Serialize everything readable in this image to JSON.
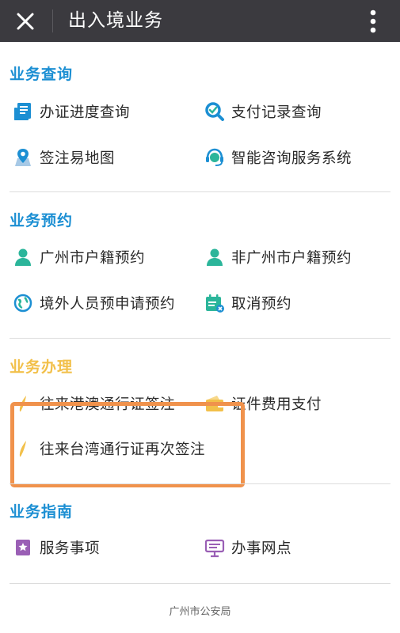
{
  "header": {
    "title": "出入境业务",
    "close_icon": "close-icon",
    "more_icon": "more-vertical-icon"
  },
  "sections": {
    "query": {
      "title": "业务查询",
      "title_color": "#1c8fd3",
      "items": [
        {
          "label": "办证进度查询",
          "icon": "progress-document-icon"
        },
        {
          "label": "支付记录查询",
          "icon": "search-icon"
        },
        {
          "label": "签注易地图",
          "icon": "map-pin-icon"
        },
        {
          "label": "智能咨询服务系统",
          "icon": "headset-icon"
        }
      ]
    },
    "booking": {
      "title": "业务预约",
      "title_color": "#1c8fd3",
      "items": [
        {
          "label": "广州市户籍预约",
          "icon": "user-icon"
        },
        {
          "label": "非广州市户籍预约",
          "icon": "user-icon"
        },
        {
          "label": "境外人员预申请预约",
          "icon": "globe-icon"
        },
        {
          "label": "取消预约",
          "icon": "calendar-cancel-icon"
        }
      ]
    },
    "process": {
      "title": "业务办理",
      "title_color": "#f2c04a",
      "items": [
        {
          "label": "往来港澳通行证签注",
          "icon": "pen-icon"
        },
        {
          "label": "证件费用支付",
          "icon": "wallet-icon"
        },
        {
          "label": "往来台湾通行证再次签注",
          "icon": "pen-icon"
        }
      ]
    },
    "guide": {
      "title": "业务指南",
      "title_color": "#1c8fd3",
      "items": [
        {
          "label": "服务事项",
          "icon": "star-bookmark-icon"
        },
        {
          "label": "办事网点",
          "icon": "location-sign-icon"
        }
      ]
    }
  },
  "footer": {
    "text": "广州市公安局"
  },
  "colors": {
    "header_bg": "#3b3a3f",
    "accent_blue": "#1c8fd3",
    "accent_green": "#2bb59a",
    "accent_yellow": "#f2c04a",
    "highlight": "#f0924c"
  }
}
